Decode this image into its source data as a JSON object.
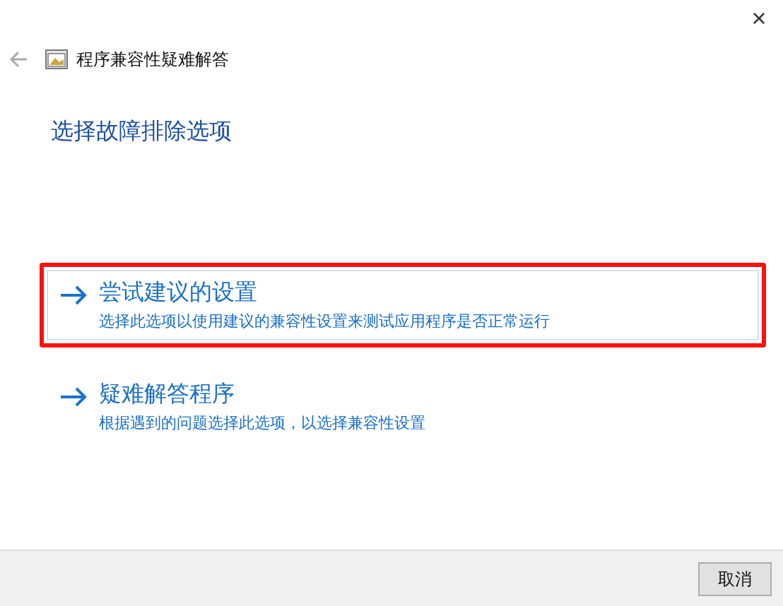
{
  "window": {
    "close": "×"
  },
  "header": {
    "title": "程序兼容性疑难解答"
  },
  "heading": "选择故障排除选项",
  "options": [
    {
      "title": "尝试建议的设置",
      "description": "选择此选项以使用建议的兼容性设置来测试应用程序是否正常运行",
      "selected": true,
      "annotated": true
    },
    {
      "title": "疑难解答程序",
      "description": "根据遇到的问题选择此选项，以选择兼容性设置",
      "selected": false,
      "annotated": false
    }
  ],
  "footer": {
    "cancel": "取消"
  }
}
